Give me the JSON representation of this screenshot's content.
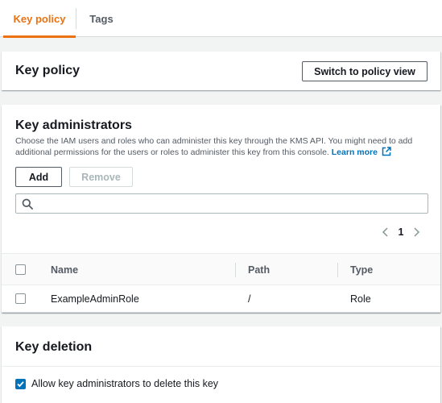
{
  "tabs": [
    {
      "label": "Key policy",
      "active": true
    },
    {
      "label": "Tags",
      "active": false
    }
  ],
  "key_policy": {
    "title": "Key policy",
    "switch_button": "Switch to policy view"
  },
  "key_administrators": {
    "title": "Key administrators",
    "description": "Choose the IAM users and roles who can administer this key through the KMS API. You might need to add additional permissions for the users or roles to administer this key from this console.",
    "learn_more": "Learn more",
    "add_button": "Add",
    "remove_button": "Remove",
    "search": {
      "value": "",
      "placeholder": ""
    },
    "pagination": {
      "current_page": "1"
    },
    "table": {
      "columns": [
        "Name",
        "Path",
        "Type"
      ],
      "rows": [
        {
          "name": "ExampleAdminRole",
          "path": "/",
          "type": "Role",
          "selected": false
        }
      ]
    }
  },
  "key_deletion": {
    "title": "Key deletion",
    "allow_label": "Allow key administrators to delete this key",
    "allow_checked": true
  },
  "colors": {
    "accent": "#ec7211",
    "link": "#0073bb",
    "checkbox_checked": "#0073bb"
  },
  "icons": {
    "search": "search-icon",
    "external_link": "external-link-icon",
    "page_prev": "chevron-left-icon",
    "page_next": "chevron-right-icon",
    "check": "check-icon"
  }
}
